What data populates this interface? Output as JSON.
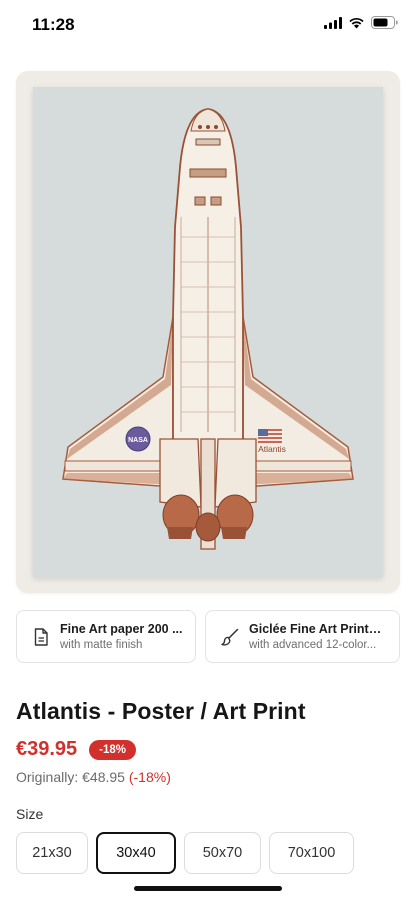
{
  "status_bar": {
    "time": "11:28",
    "icons": [
      "signal-icon",
      "wifi-icon",
      "battery-icon"
    ]
  },
  "product_image": {
    "icons": [
      "space-shuttle-illustration",
      "nasa-logo-icon",
      "us-flag-icon"
    ],
    "shuttle_name": "Atlantis",
    "nasa_label": "NASA"
  },
  "features": [
    {
      "icon": "document-icon",
      "title": "Fine Art paper 200 ...",
      "subtitle": "with matte finish"
    },
    {
      "icon": "paintbrush-icon",
      "title": "Giclée Fine Art Printing",
      "subtitle": "with advanced 12-color..."
    }
  ],
  "product": {
    "title": "Atlantis - Poster / Art Print",
    "price": "€39.95",
    "discount_badge": "-18%",
    "original_label": "Originally: €48.95",
    "original_discount": "(-18%)"
  },
  "size": {
    "label": "Size",
    "options": [
      "21x30",
      "30x40",
      "50x70",
      "70x100"
    ],
    "selected": "30x40"
  },
  "colors": {
    "accent_red": "#d2302c",
    "frame_bg": "#efebe5",
    "poster_bg": "#d6dcdc"
  }
}
